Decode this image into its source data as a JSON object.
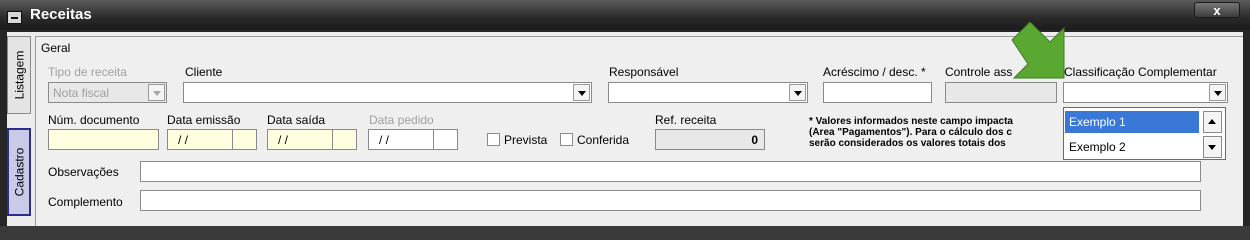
{
  "window": {
    "title": "Receitas",
    "close_label": "x"
  },
  "side_tabs": {
    "listagem": "Listagem",
    "cadastro": "Cadastro"
  },
  "section": {
    "title": "Geral"
  },
  "fields": {
    "tipo_receita": {
      "label": "Tipo de receita",
      "value": "Nota fiscal"
    },
    "cliente": {
      "label": "Cliente",
      "value": ""
    },
    "responsavel": {
      "label": "Responsável",
      "value": ""
    },
    "acrescimo": {
      "label": "Acréscimo / desc. *",
      "value": ""
    },
    "controle": {
      "label": "Controle ass",
      "value": ""
    },
    "classificacao": {
      "label": "Classificação Complementar",
      "value": ""
    },
    "num_documento": {
      "label": "Núm. documento",
      "value": ""
    },
    "data_emissao": {
      "label": "Data emissão",
      "value": "/ /"
    },
    "data_saida": {
      "label": "Data saída",
      "value": "/ /"
    },
    "data_pedido": {
      "label": "Data pedido",
      "value": "/ /"
    },
    "prevista": {
      "label": "Prevista",
      "checked": false
    },
    "conferida": {
      "label": "Conferida",
      "checked": false
    },
    "ref_receita": {
      "label": "Ref. receita",
      "value": "0"
    },
    "observacoes": {
      "label": "Observações",
      "value": ""
    },
    "complemento": {
      "label": "Complemento",
      "value": ""
    }
  },
  "note": {
    "line1": "* Valores informados neste campo impacta",
    "line2": "(Área \"Pagamentos\"). Para o cálculo dos c",
    "line3": "serão considerados os valores totais dos"
  },
  "dropdown_options": [
    {
      "label": "Exemplo 1",
      "selected": true
    },
    {
      "label": "Exemplo 2",
      "selected": false
    }
  ],
  "colors": {
    "accent": "#3a78d8",
    "arrow": "#5aa832",
    "title_bar": "#2a2a2a"
  }
}
